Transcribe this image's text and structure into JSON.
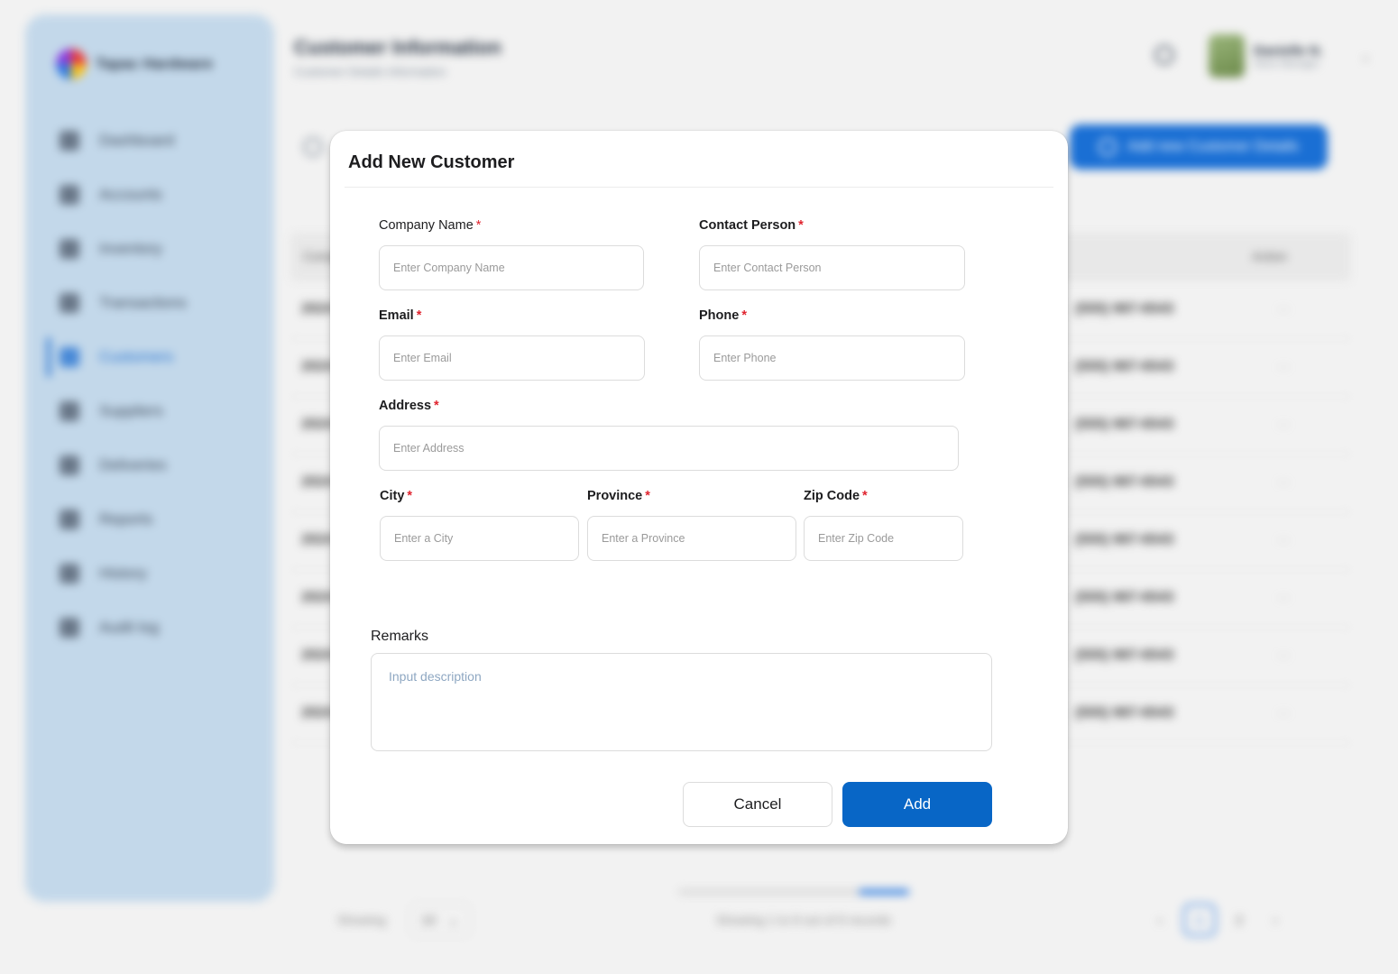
{
  "app": {
    "brand": "Tapac Hardware"
  },
  "sidebar": {
    "items": [
      {
        "label": "Dashboard",
        "icon": "dashboard-icon"
      },
      {
        "label": "Accounts",
        "icon": "accounts-icon"
      },
      {
        "label": "Inventory",
        "icon": "inventory-icon"
      },
      {
        "label": "Transactions",
        "icon": "transactions-icon"
      },
      {
        "label": "Customers",
        "icon": "customers-icon",
        "active": true
      },
      {
        "label": "Suppliers",
        "icon": "suppliers-icon"
      },
      {
        "label": "Deliveries",
        "icon": "deliveries-icon"
      },
      {
        "label": "Reports",
        "icon": "reports-icon"
      },
      {
        "label": "History",
        "icon": "history-icon"
      },
      {
        "label": "Audit log",
        "icon": "audit-log-icon"
      }
    ]
  },
  "header": {
    "title": "Customer Information",
    "subtitle": "Customer Details Information",
    "user_name": "Danielle N.",
    "user_role": "Store Manager"
  },
  "toolbar": {
    "add_details_label": "Add new Customer Details"
  },
  "table": {
    "first_col": "Company",
    "last_col": "Action",
    "rows": [
      {
        "company": "2024",
        "phone": "(555) 987-6543",
        "action": "···"
      },
      {
        "company": "2024",
        "phone": "(555) 987-6543",
        "action": "···"
      },
      {
        "company": "2024",
        "phone": "(555) 987-6543",
        "action": "···"
      },
      {
        "company": "2024",
        "phone": "(555) 987-6543",
        "action": "···"
      },
      {
        "company": "2024",
        "phone": "(555) 987-6543",
        "action": "···"
      },
      {
        "company": "2024",
        "phone": "(555) 987-6543",
        "action": "···"
      },
      {
        "company": "2024",
        "phone": "(555) 987-6543",
        "action": "···"
      },
      {
        "company": "2024",
        "phone": "(555) 987-6543",
        "action": "···"
      }
    ]
  },
  "pagination": {
    "showing_label": "Showing",
    "per_page": "10",
    "summary": "Showing 1 to 8 out of 8 records",
    "pages": [
      "‹",
      "1",
      "2",
      "›"
    ]
  },
  "modal": {
    "title": "Add New Customer",
    "required_mark": "*",
    "fields": {
      "company_name": {
        "label": "Company Name",
        "placeholder": "Enter Company Name",
        "value": ""
      },
      "contact_person": {
        "label": "Contact Person",
        "placeholder": "Enter Contact Person",
        "value": ""
      },
      "email": {
        "label": "Email",
        "placeholder": "Enter Email",
        "value": ""
      },
      "phone": {
        "label": "Phone",
        "placeholder": "Enter Phone",
        "value": ""
      },
      "address": {
        "label": "Address",
        "placeholder": "Enter Address",
        "value": ""
      },
      "city": {
        "label": "City",
        "placeholder": "Enter a City",
        "value": ""
      },
      "province": {
        "label": "Province",
        "placeholder": "Enter a Province",
        "value": ""
      },
      "zip_code": {
        "label": "Zip Code",
        "placeholder": "Enter Zip Code",
        "value": ""
      },
      "remarks": {
        "label": "Remarks",
        "placeholder": "Input description",
        "value": ""
      }
    },
    "cancel_label": "Cancel",
    "add_label": "Add"
  },
  "colors": {
    "primary": "#0866c6",
    "required": "#e0242f",
    "sidebar_bg": "#c3d8ea"
  }
}
